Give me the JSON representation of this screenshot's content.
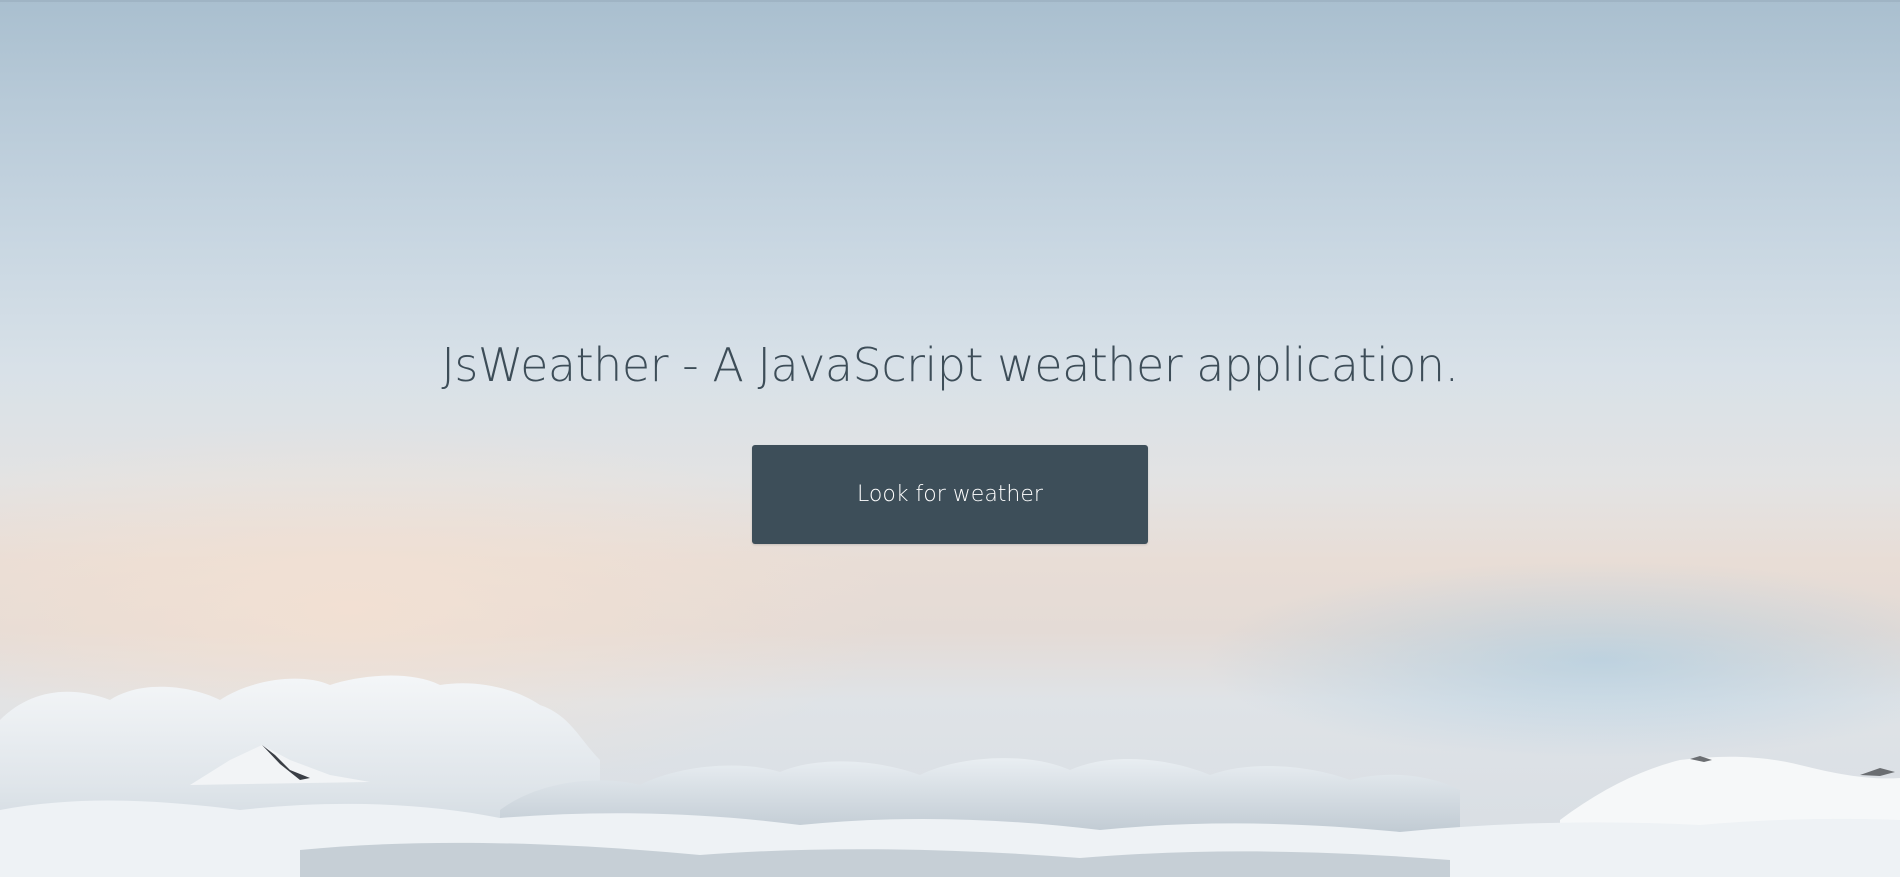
{
  "hero": {
    "title": "JsWeather - A JavaScript weather application.",
    "cta_label": "Look for weather"
  },
  "colors": {
    "title_text": "#3d4d58",
    "button_bg": "#3d4e59",
    "button_text": "#ffffff"
  }
}
